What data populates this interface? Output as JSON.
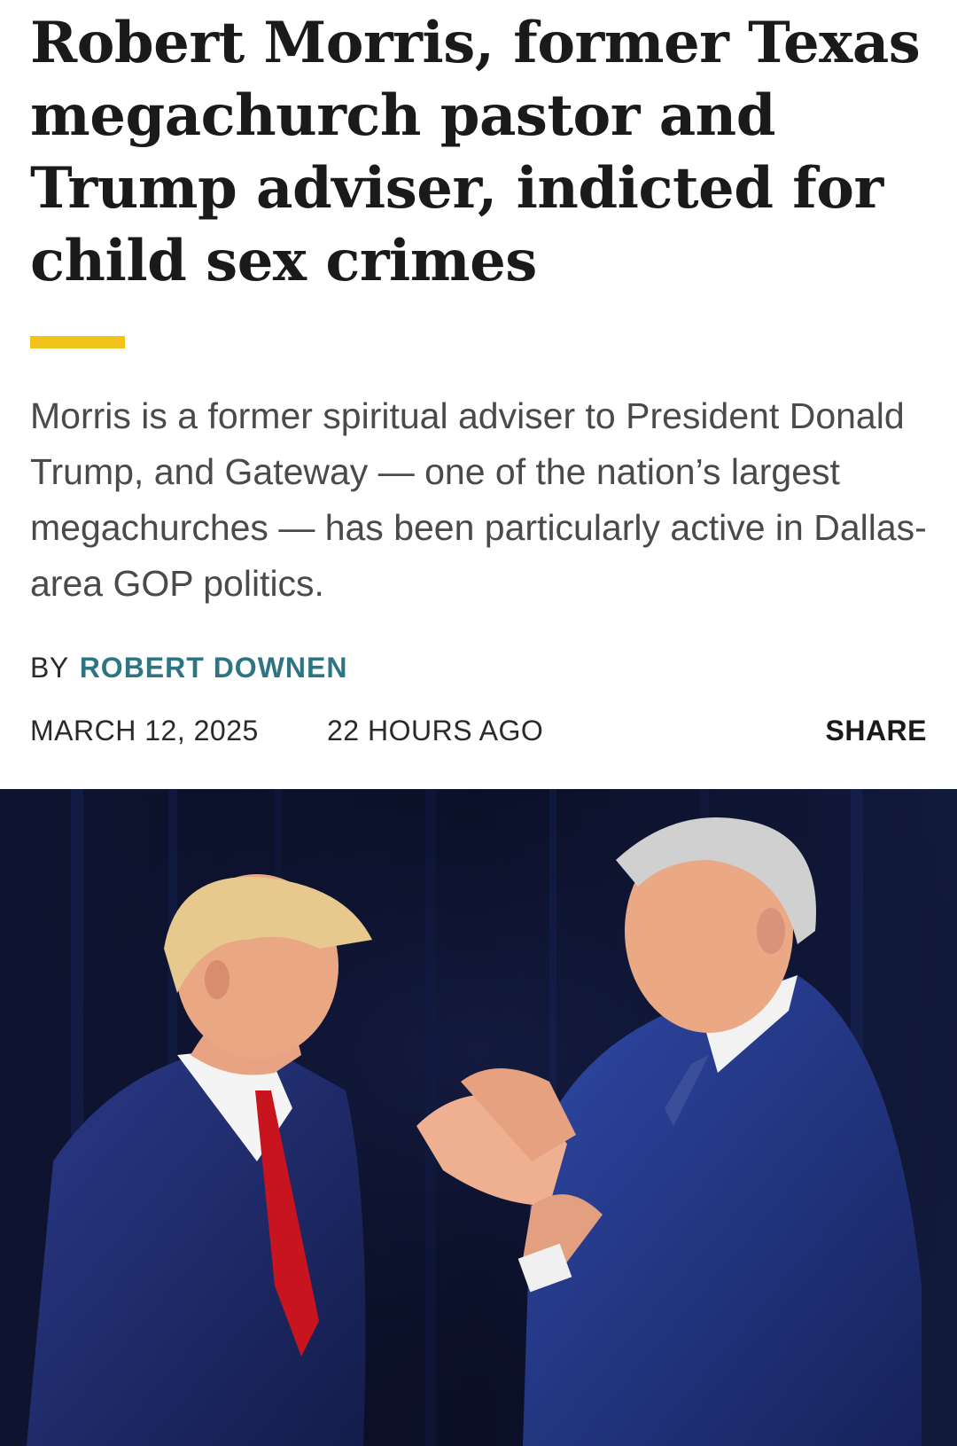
{
  "article": {
    "headline": "Robert Morris, former Texas megachurch pastor and Trump adviser, indicted for child sex crimes",
    "dek": "Morris is a former spiritual adviser to President Donald Trump, and Gateway — one of the nation’s largest megachurches — has been particularly active in Dallas-area GOP politics.",
    "byline_prefix": "BY",
    "author": "ROBERT DOWNEN",
    "date": "MARCH 12, 2025",
    "relative_time": "22 HOURS AGO",
    "share_label": "SHARE"
  },
  "colors": {
    "accent_bar": "#f2c31a",
    "author_link": "#2f7482",
    "photo_background": "#0b1024"
  },
  "photo": {
    "subject": "two men in suits on a dark stage, one clapping toward the other"
  }
}
